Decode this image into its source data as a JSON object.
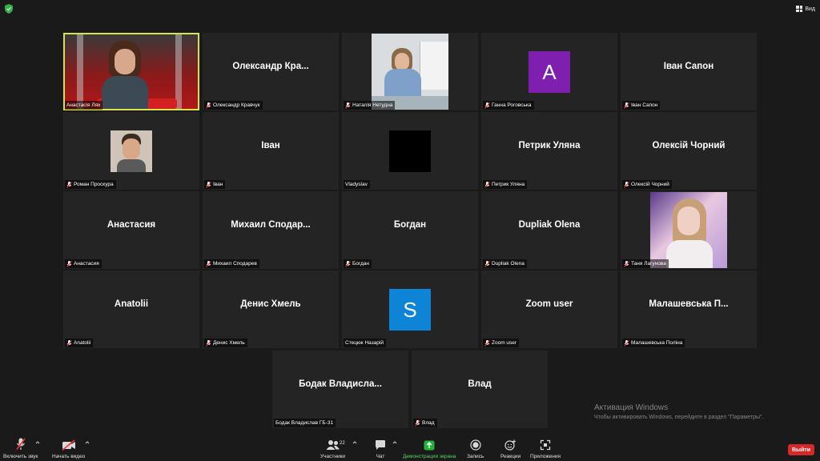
{
  "top_bar": {
    "view_label": "Вид"
  },
  "tiles": [
    {
      "label": "Анастасія Лях"
    },
    {
      "center": "Олександр  Кра...",
      "label": "Олександр Кравчук"
    },
    {
      "label": "Наталія Нетудна"
    },
    {
      "avatar": "A",
      "label": "Ганна Роговська"
    },
    {
      "center": "Іван Сапон",
      "label": "Іван Сапон"
    },
    {
      "label": "Роман Проскура"
    },
    {
      "center": "Іван",
      "label": "Іван"
    },
    {
      "label": "Vladyslav"
    },
    {
      "center": "Петрик Уляна",
      "label": "Петрик Уляна"
    },
    {
      "center": "Олексій Чорний",
      "label": "Олексій Чорний"
    },
    {
      "center": "Анастасия",
      "label": "Анастасия"
    },
    {
      "center": "Михаил  Сподар...",
      "label": "Михаил Сподарев"
    },
    {
      "center": "Богдан",
      "label": "Богдан"
    },
    {
      "center": "Dupliak Olena",
      "label": "Dupliak Olena"
    },
    {
      "label": "Таня Лагунова"
    },
    {
      "center": "Anatolii",
      "label": "Anatolii"
    },
    {
      "center": "Денис Хмель",
      "label": "Денис Хмель"
    },
    {
      "avatar": "S",
      "label": "Стецюк Назарій"
    },
    {
      "center": "Zoom user",
      "label": "Zoom user"
    },
    {
      "center": "Малашевська  П...",
      "label": "Малашевська Поліна"
    },
    {
      "center": "Бодак  Владисла...",
      "label": "Бодак Владислав ГБ-31"
    },
    {
      "center": "Влад",
      "label": "Влад"
    }
  ],
  "toolbar": {
    "unmute": "Включить звук",
    "start_video": "Начать видео",
    "participants": "Участники",
    "participants_count": "22",
    "chat": "Чат",
    "share": "Демонстрация экрана",
    "record": "Запись",
    "reactions": "Реакции",
    "apps": "Приложения",
    "leave": "Выйти"
  },
  "watermark": {
    "title": "Активация Windows",
    "subtitle": "Чтобы активировать Windows, перейдите в раздел \"Параметры\"."
  },
  "colors": {
    "active_speaker": "#d9e24a",
    "share_green": "#5ad066",
    "leave_red": "#d62828",
    "avatar_purple": "#7e1fb0",
    "avatar_blue": "#0e84d6"
  }
}
